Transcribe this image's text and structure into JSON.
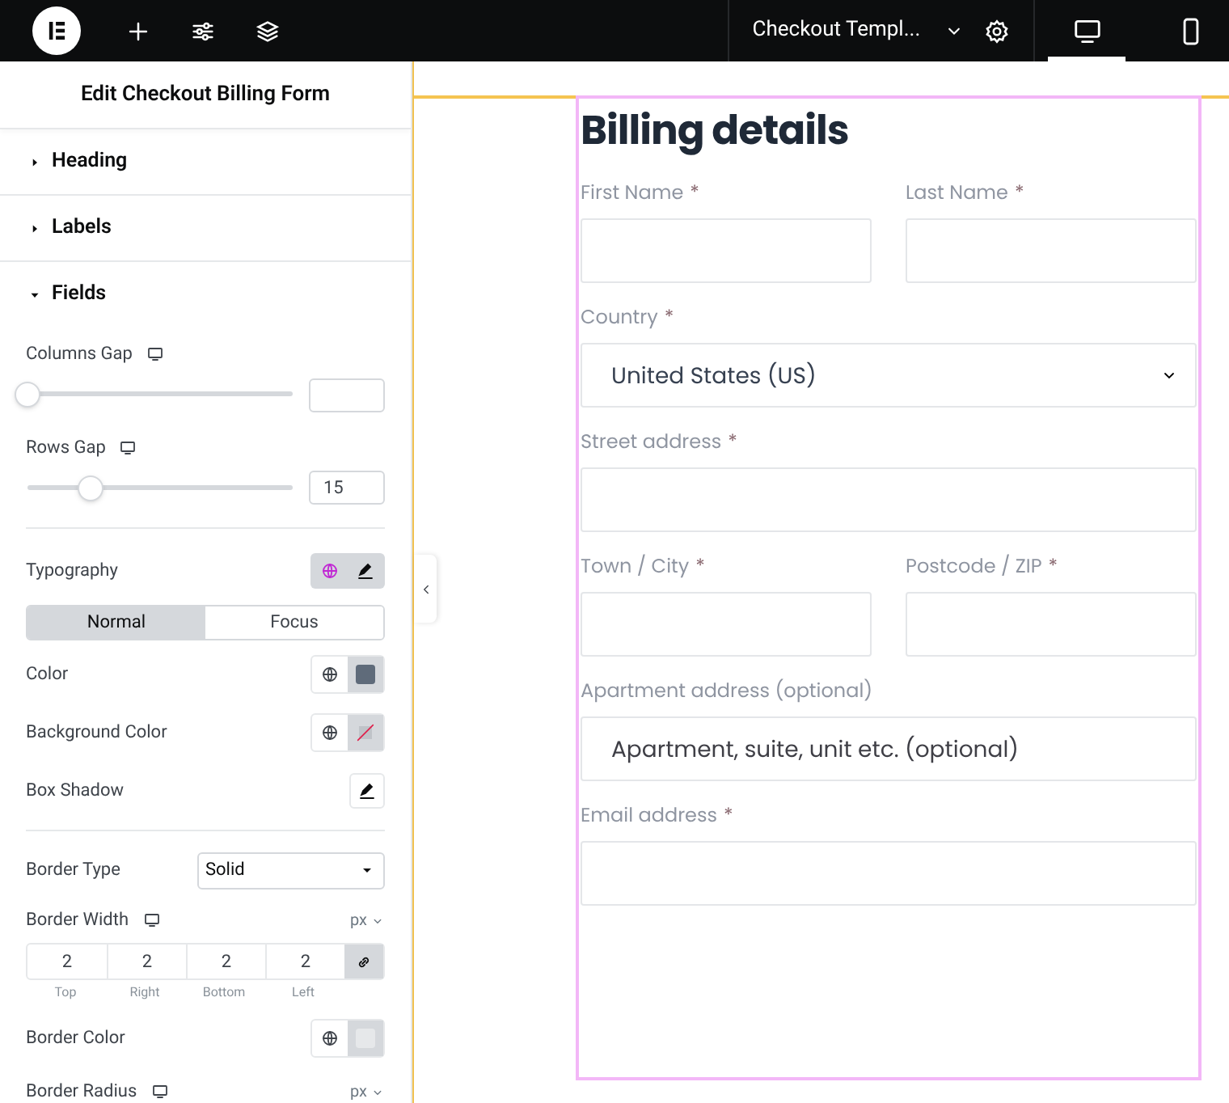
{
  "topbar": {
    "tools": [
      {
        "kind": "logo"
      },
      {
        "kind": "add"
      },
      {
        "kind": "sliders"
      },
      {
        "kind": "layers"
      }
    ],
    "document_title": "Checkout Templ...",
    "devices": [
      {
        "kind": "desktop",
        "selected": true
      },
      {
        "kind": "mobile",
        "selected": false
      }
    ]
  },
  "panel": {
    "title": "Edit Checkout Billing Form",
    "sections": [
      {
        "label": "Heading",
        "expanded": false
      },
      {
        "label": "Labels",
        "expanded": false
      },
      {
        "label": "Fields",
        "expanded": true
      }
    ],
    "controls": [
      {
        "kind": "slider",
        "label": "Columns Gap",
        "responsive": true,
        "level": 0
      },
      {
        "kind": "slider",
        "label": "Rows Gap",
        "responsive": true,
        "level": 0.25,
        "value": "15"
      },
      {
        "kind": "divider"
      },
      {
        "kind": "typography",
        "label": "Typography",
        "global_active": true
      },
      {
        "kind": "tabs",
        "tabs": [
          {
            "label": "Normal",
            "selected": true
          },
          {
            "label": "Focus",
            "selected": false
          }
        ]
      },
      {
        "kind": "color",
        "label": "Color",
        "color": "#5f6b7a"
      },
      {
        "kind": "color",
        "label": "Background Color"
      },
      {
        "kind": "shadow",
        "label": "Box Shadow"
      },
      {
        "kind": "divider"
      },
      {
        "kind": "select",
        "label": "Border Type",
        "value": "Solid"
      },
      {
        "kind": "dimensions",
        "label": "Border Width",
        "responsive": true,
        "unit": "px",
        "linked": true,
        "values": [
          {
            "value": "2",
            "label": "Top"
          },
          {
            "value": "2",
            "label": "Right"
          },
          {
            "value": "2",
            "label": "Bottom"
          },
          {
            "value": "2",
            "label": "Left"
          }
        ]
      },
      {
        "kind": "color",
        "label": "Border Color",
        "color": "#e6e8ea"
      },
      {
        "kind": "dimensions",
        "label": "Border Radius",
        "responsive": true,
        "unit": "px"
      }
    ]
  },
  "form": {
    "heading": "Billing details",
    "rows": [
      {
        "fields": [
          {
            "kind": "text",
            "label": "First Name",
            "required_mark": "*"
          },
          {
            "kind": "text",
            "label": "Last Name",
            "required_mark": "*"
          }
        ]
      },
      {
        "fields": [
          {
            "kind": "select",
            "label": "Country",
            "required_mark": "*",
            "value": "United States (US)"
          }
        ]
      },
      {
        "fields": [
          {
            "kind": "text",
            "label": "Street address",
            "required_mark": "*"
          }
        ]
      },
      {
        "fields": [
          {
            "kind": "text",
            "label": "Town / City",
            "required_mark": "*"
          },
          {
            "kind": "text",
            "label": "Postcode / ZIP",
            "required_mark": "*"
          }
        ]
      },
      {
        "fields": [
          {
            "kind": "text",
            "label": "Apartment address (optional)",
            "placeholder": "Apartment, suite, unit etc. (optional)"
          }
        ]
      },
      {
        "fields": [
          {
            "kind": "text",
            "label": "Email address",
            "required_mark": "*"
          }
        ]
      }
    ]
  }
}
